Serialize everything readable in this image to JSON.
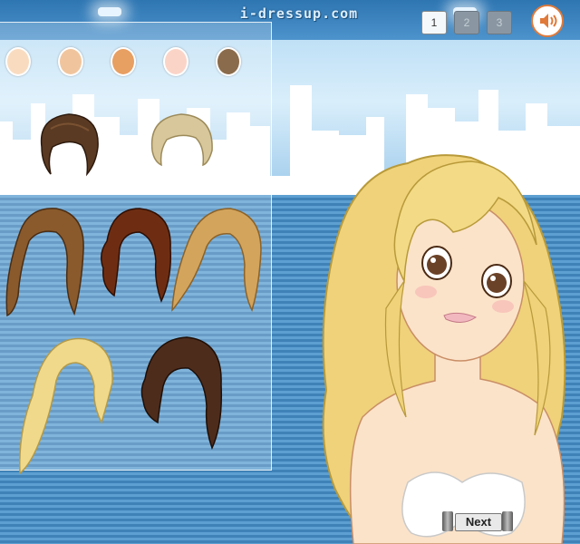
{
  "header": {
    "logo_text": "i-dressup.com",
    "pages": [
      {
        "label": "1",
        "active": true
      },
      {
        "label": "2",
        "active": false
      },
      {
        "label": "3",
        "active": false
      }
    ],
    "sound_icon": "speaker-icon"
  },
  "skin_tones": [
    "#f9dcc0",
    "#f0c59e",
    "#e89f62",
    "#fbd4c8",
    "#8a6b4b"
  ],
  "hair_options": [
    {
      "name": "brown-updo",
      "color": "#5a3a22"
    },
    {
      "name": "blonde-short",
      "color": "#d8c79a"
    },
    {
      "name": "brown-long-wavy",
      "color": "#8a5a2c"
    },
    {
      "name": "auburn-curly",
      "color": "#6e2d12"
    },
    {
      "name": "honey-long",
      "color": "#d3a45c"
    },
    {
      "name": "blonde-wavy",
      "color": "#f0d98a"
    },
    {
      "name": "dark-brown-bob",
      "color": "#4e2c1c"
    }
  ],
  "model": {
    "hair_color": "#efd27a",
    "skin": "#fbe3c9"
  },
  "footer": {
    "next_label": "Next"
  }
}
